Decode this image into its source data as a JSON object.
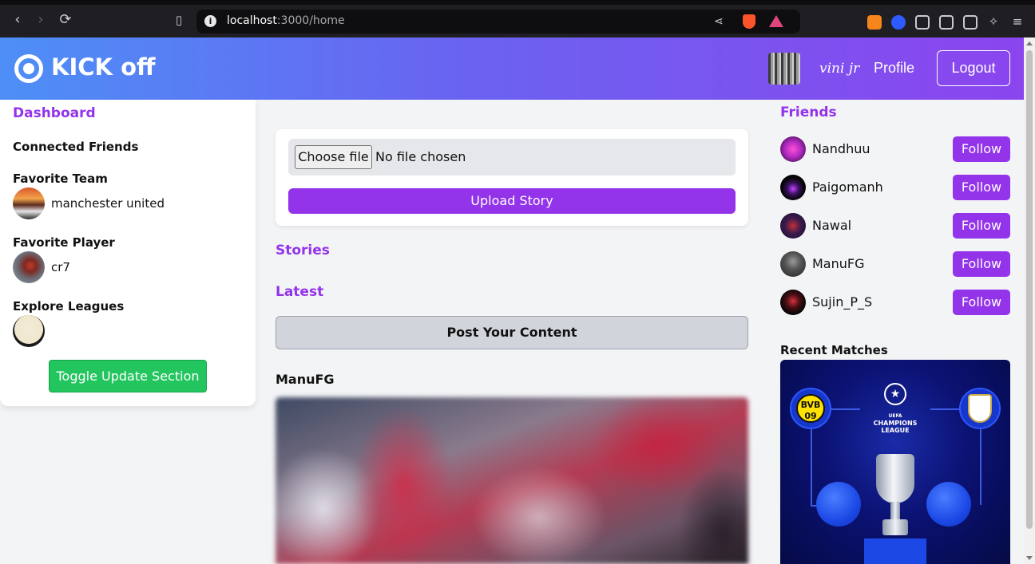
{
  "browser": {
    "url_host": "localhost",
    "url_path": ":3000/home"
  },
  "header": {
    "brand": "KICK off",
    "username": "vini jr",
    "profile_label": "Profile",
    "logout_label": "Logout"
  },
  "left": {
    "dashboard_title": "Dashboard",
    "connected_friends": "Connected Friends",
    "favorite_team_heading": "Favorite Team",
    "favorite_team": "manchester united",
    "favorite_player_heading": "Favorite Player",
    "favorite_player": "cr7",
    "explore_leagues_heading": "Explore Leagues",
    "toggle_label": "Toggle Update Section"
  },
  "main": {
    "choose_file_label": "Choose file",
    "no_file_text": "No file chosen",
    "upload_story_label": "Upload Story",
    "stories_heading": "Stories",
    "latest_heading": "Latest",
    "post_content_label": "Post Your Content",
    "post_author": "ManuFG"
  },
  "right": {
    "friends_heading": "Friends",
    "friends": [
      {
        "name": "Nandhuu",
        "action": "Follow"
      },
      {
        "name": "Paigomanh",
        "action": "Follow"
      },
      {
        "name": "Nawal",
        "action": "Follow"
      },
      {
        "name": "ManuFG",
        "action": "Follow"
      },
      {
        "name": "Sujin_P_S",
        "action": "Follow"
      }
    ],
    "recent_matches_heading": "Recent Matches",
    "match_card": {
      "home_badge": "BVB 09",
      "competition": "CHAMPIONS LEAGUE",
      "competition_small": "UEFA"
    }
  },
  "colors": {
    "accent": "#9333ea",
    "toggle": "#22c55e",
    "header_start": "#4d8ff6",
    "header_end": "#8b45ee"
  }
}
